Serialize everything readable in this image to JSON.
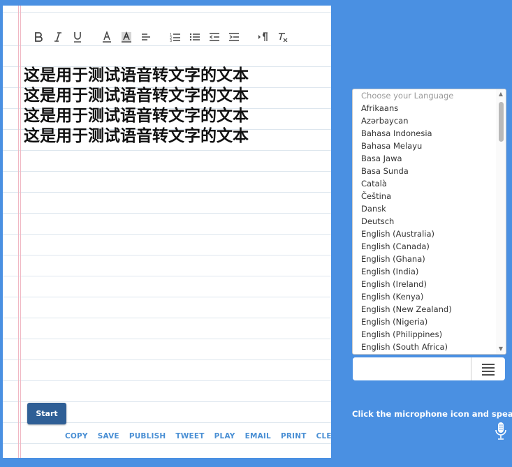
{
  "editor": {
    "lines": [
      "这是用于测试语音转文字的文本",
      "这是用于测试语音转文字的文本",
      "这是用于测试语音转文字的文本",
      "这是用于测试语音转文字的文本"
    ]
  },
  "toolbar": {
    "buttons": [
      "bold-icon",
      "italic-icon",
      "underline-icon",
      "font-color-icon",
      "highlight-icon",
      "align-left-icon",
      "ordered-list-icon",
      "bullet-list-icon",
      "outdent-icon",
      "indent-icon",
      "text-direction-icon",
      "clear-format-icon"
    ]
  },
  "start_label": "Start",
  "actions": [
    "COPY",
    "SAVE",
    "PUBLISH",
    "TWEET",
    "PLAY",
    "EMAIL",
    "PRINT",
    "CLEAR"
  ],
  "language": {
    "placeholder": "Choose your Language",
    "options": [
      "Afrikaans",
      "Azərbaycan",
      "Bahasa Indonesia",
      "Bahasa Melayu",
      "Basa Jawa",
      "Basa Sunda",
      "Català",
      "Čeština",
      "Dansk",
      "Deutsch",
      "English (Australia)",
      "English (Canada)",
      "English (Ghana)",
      "English (India)",
      "English (Ireland)",
      "English (Kenya)",
      "English (New Zealand)",
      "English (Nigeria)",
      "English (Philippines)",
      "English (South Africa)"
    ]
  },
  "hint": "Click the microphone icon and speak",
  "colors": {
    "background": "#4a90e2",
    "start_button": "#2f5f96",
    "action_link": "#4a8fd4"
  }
}
